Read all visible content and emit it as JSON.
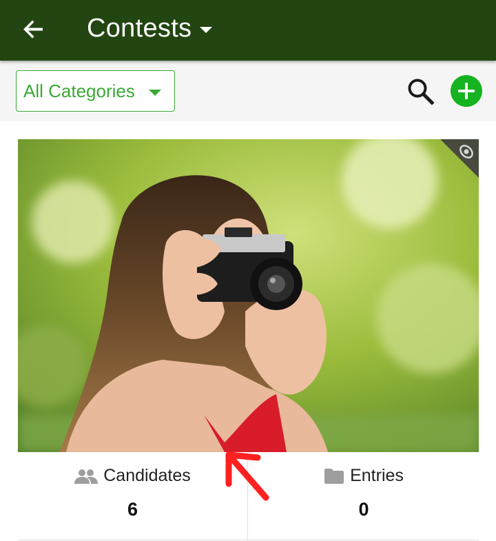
{
  "appbar": {
    "title": "Contests",
    "background": "#234511"
  },
  "filter": {
    "category_label": "All Categories",
    "accent": "#3aa935"
  },
  "contest_card": {
    "image": "woman-with-camera-photo",
    "candidates_label": "Candidates",
    "candidates_count": "6",
    "entries_label": "Entries",
    "entries_count": "0"
  },
  "icons": {
    "back": "arrow-left-icon",
    "title_dropdown": "caret-down-icon",
    "category_dropdown": "caret-down-icon",
    "search": "search-icon",
    "add": "add-circle-icon",
    "corner": "visibility-icon",
    "candidates": "people-icon",
    "entries": "folder-icon"
  },
  "colors": {
    "add_button": "#15b31f",
    "annotation_arrow": "#ff2020"
  }
}
